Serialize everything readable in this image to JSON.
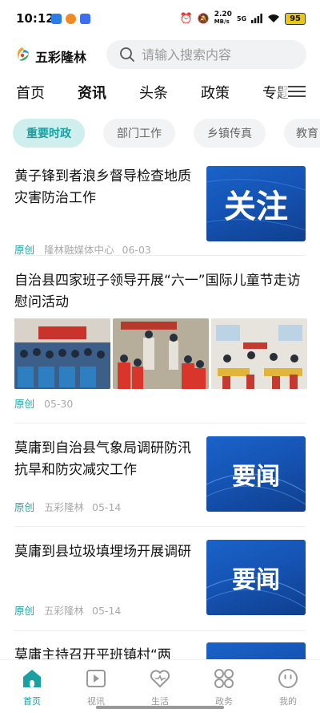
{
  "status_bar": {
    "time": "10:12",
    "net_speed_value": "2.20",
    "net_speed_unit": "MB/s",
    "network_type": "5G",
    "battery": "95"
  },
  "header": {
    "app_name": "五彩隆林",
    "search_placeholder": "请输入搜索内容"
  },
  "main_tabs": [
    {
      "label": "首页",
      "active": false
    },
    {
      "label": "资讯",
      "active": true
    },
    {
      "label": "头条",
      "active": false
    },
    {
      "label": "政策",
      "active": false
    },
    {
      "label": "专题",
      "active": false
    }
  ],
  "sub_tabs": [
    {
      "label": "重要时政",
      "active": true
    },
    {
      "label": "部门工作",
      "active": false
    },
    {
      "label": "乡镇传真",
      "active": false
    },
    {
      "label": "教育",
      "active": false
    }
  ],
  "news": [
    {
      "title": "黄子锋到者浪乡督导检查地质灾害防治工作",
      "tag": "原创",
      "source": "隆林融媒体中心",
      "date": "06-03",
      "thumb_text": "关注"
    },
    {
      "title": "自治县四家班子领导开展“六一”国际儿童节走访慰问活动",
      "tag": "原创",
      "source": "",
      "date": "05-30"
    },
    {
      "title": "莫庸到自治县气象局调研防汛抗旱和防灾减灾工作",
      "tag": "原创",
      "source": "五彩隆林",
      "date": "05-14",
      "thumb_text": "要闻"
    },
    {
      "title": "莫庸到县垃圾填埋场开展调研",
      "tag": "原创",
      "source": "五彩隆林",
      "date": "05-14",
      "thumb_text": "要闻"
    },
    {
      "title": "莫庸主持召开平班镇村“两",
      "tag": "",
      "source": "",
      "date": ""
    }
  ],
  "bottom_nav": [
    {
      "label": "首页",
      "icon": "home-icon",
      "active": true
    },
    {
      "label": "视讯",
      "icon": "video-icon",
      "active": false
    },
    {
      "label": "生活",
      "icon": "heart-icon",
      "active": false
    },
    {
      "label": "政务",
      "icon": "grid-icon",
      "active": false
    },
    {
      "label": "我的",
      "icon": "profile-icon",
      "active": false
    }
  ],
  "colors": {
    "accent": "#1aa0a0",
    "sub_tab_active_bg": "#cfeeee",
    "thumb_blue": "#1a63c9"
  }
}
